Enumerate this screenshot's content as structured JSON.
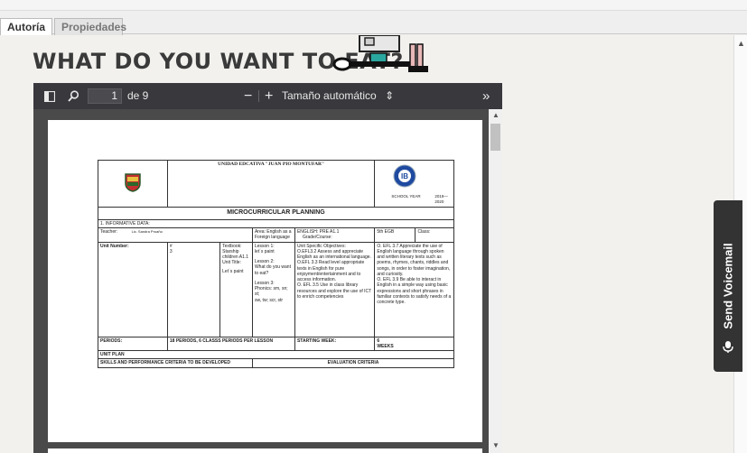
{
  "tabs": [
    "Autoría",
    "Propiedades"
  ],
  "heading": "WHAT DO YOU WANT TO EAT?",
  "viewer": {
    "page_number": "1",
    "page_total": "de 9",
    "minus": "−",
    "plus": "+",
    "zoom": "Tamaño automático",
    "more": "»"
  },
  "doc": {
    "school_title": "UNIDAD EDCATIVA \"JUAN PIO MONTUFAR\"",
    "ib_label": "IB",
    "school_year_label": "SCHOOL YEAR",
    "school_year": "2019—2020",
    "planning_title": "MICROCURRICULAR PLANNING",
    "info_label": "1. INFORMATIVE DATA:",
    "teacher_label": "Teacher:",
    "teacher_name": "Lic. Sandra Proaño",
    "area_label": "Area: English as a Foreign language",
    "english_label": "ENGLISH: PRE A1.1",
    "grade_label": "Grade/Course:",
    "grade_value": "5th EGB",
    "class_label": "Class:",
    "unit_number_label": "Unit Number:",
    "unit_hash": "#",
    "unit_num": "3",
    "textbook_label": "Textbook:",
    "textbook_value": "Starship children A1.1",
    "unit_title_label": "Unit Title:",
    "unit_title_value": "Let´s paint",
    "lessons": [
      "Lesson 1:",
      "let´s paint",
      "Lesson 2:",
      "What do you want to eat?",
      "Lesson 3:",
      "Phonics: sm, sn; st;",
      "sw, tw; scr, str"
    ],
    "objectives_title": "Unit Specific Objectives:",
    "objectives": [
      "O.EFL3.2 Assess and appreciate English as an international language.",
      "O.EFL 3.3 Read level appropriate texts in English for pure enjoyment/entertainment and to access information.",
      "O. EFL 3.5 Use in class library resources and explore the use of ICT to enrich competencies"
    ],
    "criteria_text": [
      "O. EFL 3.7 Appreciate the use of English language through spoken and written literary texts such as poems, rhymes, chants, riddles and songs, in order to foster imagination, and curiosity.",
      "O. EFL 3.9 Be able to interact in English in a simple way using basic expressions and short phrases in familiar contexts to satisfy needs of a concrete type."
    ],
    "periods_label": "PERIODS:",
    "periods_value": "18 PERIODS, 6 CLASSS PERIODS PER LESSON",
    "starting_label": "STARTING WEEK:",
    "weeks_value": "6",
    "weeks_label": "WEEKS",
    "unit_plan_label": "UNIT PLAN",
    "skills_label": "SKILLS AND PERFORMANCE CRITERIA TO BE DEVELOPED",
    "evaluation_label": "EVALUATION CRITERIA"
  },
  "voicemail": {
    "label": "Send Voicemail"
  },
  "colors": {
    "toolbar": "#38383d",
    "viewer_bg": "#4a4a4a",
    "voicemail_bg": "#333333"
  }
}
